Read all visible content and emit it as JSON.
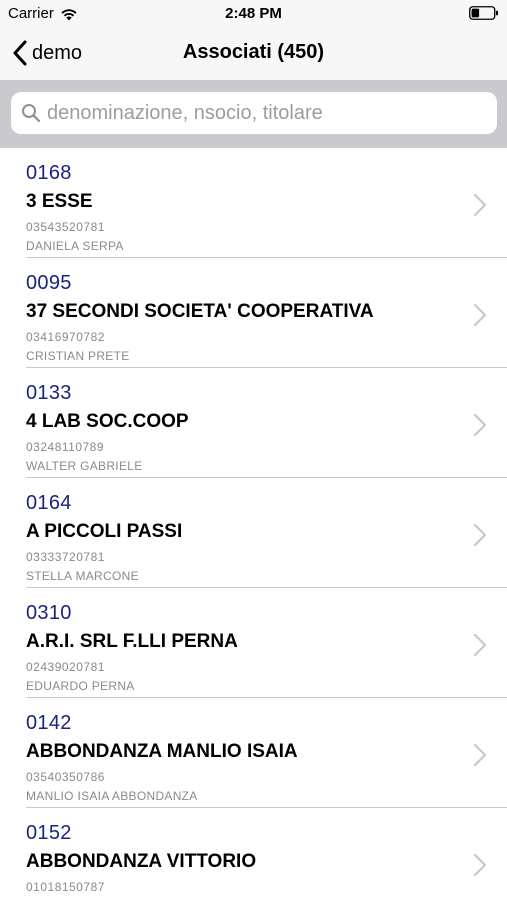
{
  "status_bar": {
    "carrier": "Carrier",
    "time": "2:48 PM",
    "wifi_icon": "wifi-icon",
    "battery_icon": "battery-icon"
  },
  "nav": {
    "back_label": "demo",
    "title": "Associati (450)"
  },
  "search": {
    "placeholder": "denominazione, nsocio, titolare",
    "value": ""
  },
  "colors": {
    "code": "#1a237e",
    "search_bg": "#c9c9ce",
    "bar_bg": "#f7f7f7",
    "secondary_text": "#8a8a8f"
  },
  "associates": [
    {
      "code": "0168",
      "name": "3 ESSE",
      "vat": "03543520781",
      "owner": "DANIELA SERPA"
    },
    {
      "code": "0095",
      "name": "37 SECONDI SOCIETA' COOPERATIVA",
      "vat": "03416970782",
      "owner": "CRISTIAN PRETE"
    },
    {
      "code": "0133",
      "name": "4 LAB SOC.COOP",
      "vat": "03248110789",
      "owner": "WALTER GABRIELE"
    },
    {
      "code": "0164",
      "name": "A PICCOLI PASSI",
      "vat": "03333720781",
      "owner": "STELLA MARCONE"
    },
    {
      "code": "0310",
      "name": "A.R.I. SRL F.LLI PERNA",
      "vat": "02439020781",
      "owner": "EDUARDO PERNA"
    },
    {
      "code": "0142",
      "name": "ABBONDANZA MANLIO ISAIA",
      "vat": "03540350786",
      "owner": "MANLIO ISAIA ABBONDANZA"
    },
    {
      "code": "0152",
      "name": "ABBONDANZA VITTORIO",
      "vat": "01018150787",
      "owner": ""
    }
  ]
}
